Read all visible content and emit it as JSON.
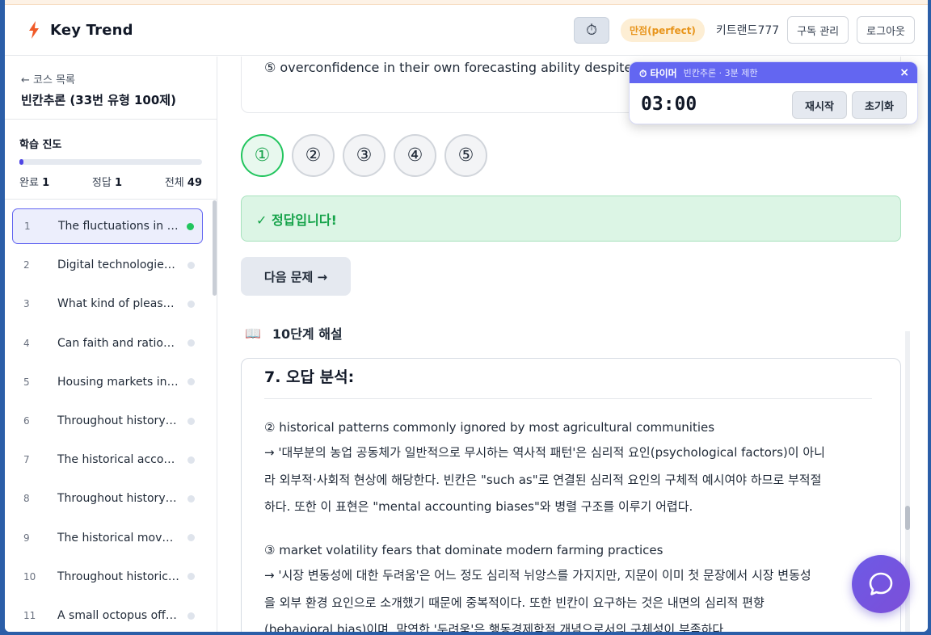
{
  "header": {
    "brand": "Key Trend",
    "timer_icon": "⏱",
    "badge": "만점(perfect)",
    "username": "키트랜드777",
    "subscription_button": "구독 관리",
    "logout_button": "로그아웃"
  },
  "sidebar": {
    "back_link": "← 코스 목록",
    "course_title": "빈칸추론 (33번 유형 100제)",
    "progress": {
      "title": "학습 진도",
      "fraction": 0.02,
      "done_label": "완료",
      "done_value": "1",
      "correct_label": "정답",
      "correct_value": "1",
      "total_label": "전체",
      "total_value": "49"
    },
    "items": [
      {
        "num": "1",
        "title": "The fluctuations in agricultural commodity prices",
        "active": true
      },
      {
        "num": "2",
        "title": "Digital technologies have transformed",
        "active": false
      },
      {
        "num": "3",
        "title": "What kind of pleasure do we get",
        "active": false
      },
      {
        "num": "4",
        "title": "Can faith and rationality coexist",
        "active": false
      },
      {
        "num": "5",
        "title": "Housing markets in urban areas",
        "active": false
      },
      {
        "num": "6",
        "title": "Throughout history, societies have",
        "active": false
      },
      {
        "num": "7",
        "title": "The historical accounts of",
        "active": false
      },
      {
        "num": "8",
        "title": "Throughout history, humans have",
        "active": false
      },
      {
        "num": "9",
        "title": "The historical movement of",
        "active": false
      },
      {
        "num": "10",
        "title": "Throughout historical periods",
        "active": false
      },
      {
        "num": "11",
        "title": "A small octopus offers",
        "active": false
      }
    ]
  },
  "main": {
    "prev_option_text": "⑤ overconfidence in their own forecasting ability despite",
    "options": [
      "①",
      "②",
      "③",
      "④",
      "⑤"
    ],
    "selected_option": 0,
    "correct_message": "✓ 정답입니다!",
    "next_button": "다음 문제 →",
    "explanation_icon": "📖",
    "explanation_title": "10단계 해설",
    "step_title": "7. 오답 분석:",
    "analysis": [
      {
        "option": "② historical patterns commonly ignored by most agricultural communities",
        "lines": [
          "→ '대부분의 농업 공동체가 일반적으로 무시하는 역사적 패턴'은 심리적 요인(psychological factors)이 아니",
          "라 외부적·사회적 현상에 해당한다. 빈칸은 \"such as\"로 연결된 심리적 요인의 구체적 예시여야 하므로 부적절",
          "하다. 또한 이 표현은 \"mental accounting biases\"와 병렬 구조를 이루기 어렵다."
        ]
      },
      {
        "option": "③ market volatility fears that dominate modern farming practices",
        "lines": [
          "→ '시장 변동성에 대한 두려움'은 어느 정도 심리적 뉘앙스를 가지지만, 지문이 이미 첫 문장에서 시장 변동성",
          "을 외부 환경 요인으로 소개했기 때문에 중복적이다. 또한 빈칸이 요구하는 것은 내면의 심리적 편향",
          "(behavioral bias)이며, 막연한 '두려움'은 행동경제학적 개념으로서의 구체성이 부족하다."
        ]
      }
    ]
  },
  "timer": {
    "label": "⏱ 타이머",
    "subtitle": "빈칸추론 · 3분 제한",
    "close": "×",
    "time": "03:00",
    "restart_button": "재시작",
    "reset_button": "초기화"
  },
  "colors": {
    "accent": "#6366f1",
    "success": "#22c55e",
    "brand_bolt": "#f05a28",
    "badge_text": "#e8951c"
  }
}
